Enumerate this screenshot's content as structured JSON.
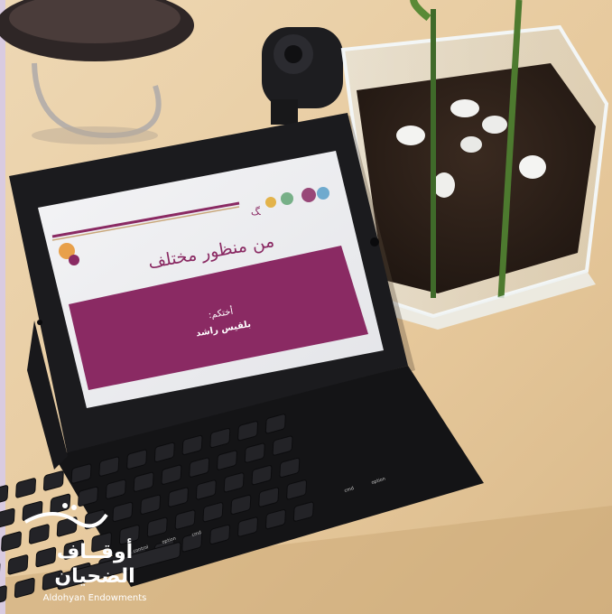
{
  "slide": {
    "title": "من منظور مختلف",
    "label": "أختكم:",
    "name": "بلقيس راشد"
  },
  "watermark": {
    "arabic_line1": "أوقــاف",
    "arabic_line2": "الضحيان",
    "english": "Aldohyan Endowments"
  },
  "keyboard": {
    "option_left": "option",
    "cmd_left": "cmd",
    "cmd_right": "cmd",
    "option_right": "option",
    "control": "control"
  },
  "colors": {
    "slide_accent": "#8a2a63",
    "table": "#e9cfa6",
    "watermark": "#ffffff"
  }
}
